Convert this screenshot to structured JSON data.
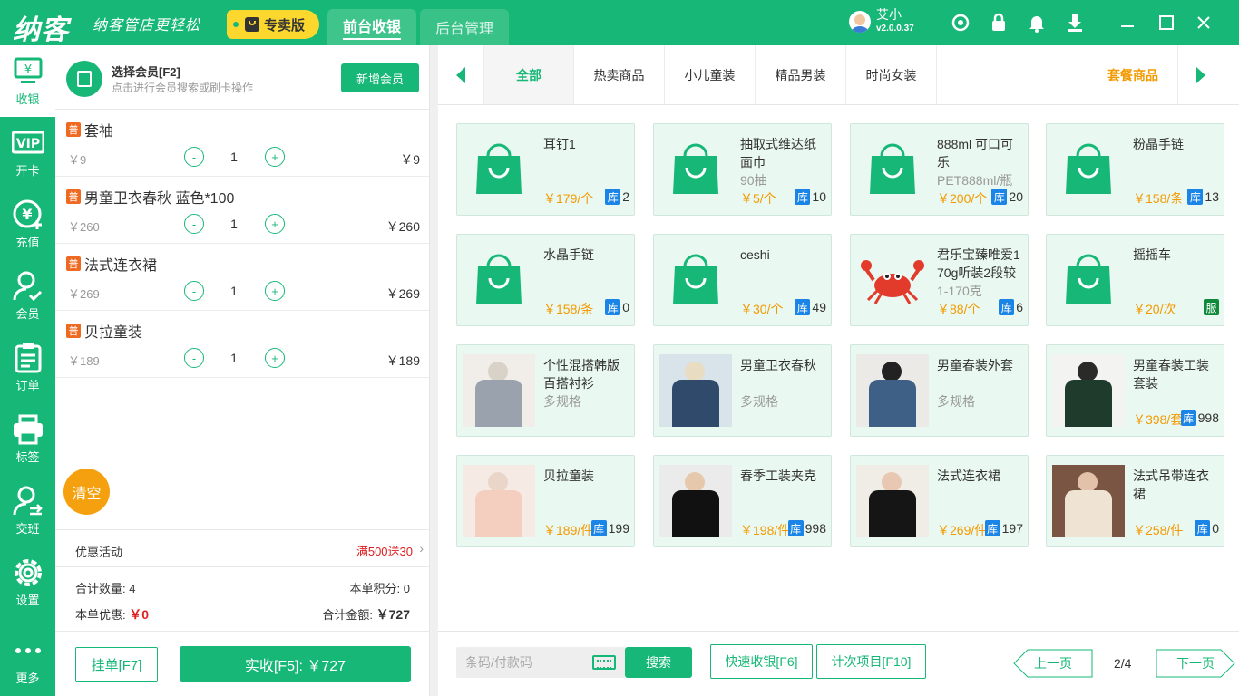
{
  "app": {
    "logo": "纳客",
    "slogan": "纳客管店更轻松",
    "edition": "专卖版",
    "tabs": [
      {
        "label": "前台收银"
      },
      {
        "label": "后台管理"
      }
    ],
    "user": {
      "name": "艾小",
      "version": "v2.0.0.37"
    },
    "icons": [
      "headset-icon",
      "lock-icon",
      "bell-icon",
      "download-icon",
      "minimize-icon",
      "maximize-icon",
      "close-icon"
    ]
  },
  "nav": [
    {
      "label": "收银",
      "icon": "cashier-icon"
    },
    {
      "label": "开卡",
      "icon": "vip-icon"
    },
    {
      "label": "充值",
      "icon": "recharge-icon"
    },
    {
      "label": "会员",
      "icon": "member-icon"
    },
    {
      "label": "订单",
      "icon": "order-icon"
    },
    {
      "label": "标签",
      "icon": "printer-icon"
    },
    {
      "label": "交班",
      "icon": "shift-icon"
    },
    {
      "label": "设置",
      "icon": "settings-icon"
    },
    {
      "label": "更多",
      "icon": "more-icon"
    }
  ],
  "member": {
    "title": "选择会员[F2]",
    "subtitle": "点击进行会员搜索或刷卡操作",
    "add_label": "新增会员"
  },
  "cart": {
    "tag": "普",
    "items": [
      {
        "name": "套袖",
        "price": "￥9",
        "qty": "1",
        "total": "￥9"
      },
      {
        "name": "男童卫衣春秋 蓝色*100",
        "price": "￥260",
        "qty": "1",
        "total": "￥260"
      },
      {
        "name": "法式连衣裙",
        "price": "￥269",
        "qty": "1",
        "total": "￥269"
      },
      {
        "name": "贝拉童装",
        "price": "￥189",
        "qty": "1",
        "total": "￥189"
      }
    ],
    "clear_label": "清空",
    "promo_label": "优惠活动",
    "promo_value": "满500送30",
    "total_qty_label": "合计数量:",
    "total_qty": "4",
    "points_label": "本单积分:",
    "points": "0",
    "discount_label": "本单优惠:",
    "discount": "￥0",
    "amount_label": "合计金额:",
    "amount": "￥727",
    "hang_label": "挂单[F7]",
    "pay_label": "实收[F5]: ￥727"
  },
  "categories": {
    "tabs": [
      "全部",
      "热卖商品",
      "小儿童装",
      "精品男装",
      "时尚女装"
    ],
    "package_label": "套餐商品"
  },
  "stock_tag": "库",
  "service_tag": "服",
  "products": [
    {
      "name": "耳钉1",
      "spec": "",
      "price": "￥179/个",
      "stock": "2",
      "img": "bag-icon"
    },
    {
      "name": "抽取式维达纸面巾",
      "spec": "90抽",
      "price": "￥5/个",
      "stock": "10",
      "img": "bag-icon"
    },
    {
      "name": "888ml 可口可乐",
      "spec": "PET888ml/瓶",
      "price": "￥200/个",
      "stock": "20",
      "img": "bag-icon"
    },
    {
      "name": "粉晶手链",
      "spec": "",
      "price": "￥158/条",
      "stock": "13",
      "img": "bag-icon"
    },
    {
      "name": "水晶手链",
      "spec": "",
      "price": "￥158/条",
      "stock": "0",
      "img": "bag-icon"
    },
    {
      "name": "ceshi",
      "spec": "",
      "price": "￥30/个",
      "stock": "49",
      "img": "bag-icon"
    },
    {
      "name": "君乐宝臻唯爱170g听装2段较",
      "spec": "1-170克",
      "price": "￥88/个",
      "stock": "6",
      "img": "crab-icon"
    },
    {
      "name": "摇摇车",
      "spec": "",
      "price": "￥20/次",
      "stock": "",
      "img": "bag-icon"
    },
    {
      "name": "个性混搭韩版百搭衬衫",
      "spec": "多规格",
      "price": "",
      "stock": "",
      "img": "photo-shirt"
    },
    {
      "name": "男童卫衣春秋",
      "spec": "多规格",
      "price": "",
      "stock": "",
      "img": "photo-boy"
    },
    {
      "name": "男童春装外套",
      "spec": "多规格",
      "price": "",
      "stock": "",
      "img": "photo-jacket"
    },
    {
      "name": "男童春装工装套装",
      "spec": "",
      "price": "￥398/套",
      "stock": "998",
      "img": "photo-suit"
    },
    {
      "name": "贝拉童装",
      "spec": "",
      "price": "￥189/件",
      "stock": "199",
      "img": "photo-girl"
    },
    {
      "name": "春季工装夹克",
      "spec": "",
      "price": "￥198/件",
      "stock": "998",
      "img": "photo-man"
    },
    {
      "name": "法式连衣裙",
      "spec": "",
      "price": "￥269/件",
      "stock": "197",
      "img": "photo-dress"
    },
    {
      "name": "法式吊带连衣裙",
      "spec": "",
      "price": "￥258/件",
      "stock": "0",
      "img": "photo-lady"
    }
  ],
  "bottom": {
    "barcode_placeholder": "条码/付款码",
    "search_label": "搜索",
    "quick_label": "快速收银[F6]",
    "times_label": "计次项目[F10]",
    "prev_label": "上一页",
    "next_label": "下一页",
    "page": "2/4"
  }
}
